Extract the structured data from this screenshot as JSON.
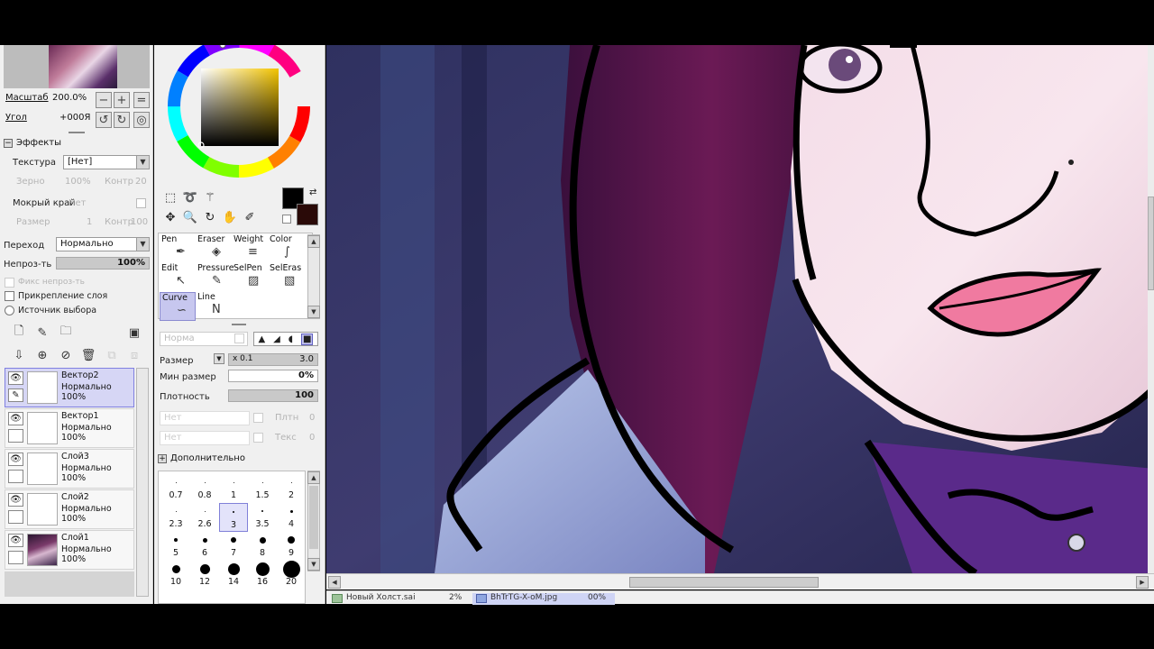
{
  "left_panel": {
    "zoom_label": "Масштаб",
    "zoom_value": "200.0%",
    "angle_label": "Угол",
    "angle_value": "+000Я",
    "effects_title": "Эффекты",
    "texture_label": "Текстура",
    "texture_value": "[Нет]",
    "grain_label": "Зерно",
    "grain_value": "100%",
    "contrast_label": "Контр",
    "contrast_value": "20",
    "wet_edge_label": "Мокрый край",
    "wet_edge_value": "Нет",
    "size_label": "Размер",
    "size_value": "1",
    "contrast2_label": "Контр",
    "contrast2_value": "100",
    "blending_label": "Переход",
    "blending_value": "Нормально",
    "opacity_label": "Непроз-ть",
    "opacity_value": "100%",
    "fix_opacity_label": "Фикс непроз-ть",
    "clip_layer_label": "Прикрепление слоя",
    "selection_source_label": "Источник выбора",
    "layers": [
      {
        "name": "Вектор2",
        "mode": "Нормально",
        "opacity": "100%",
        "selected": true
      },
      {
        "name": "Вектор1",
        "mode": "Нормально",
        "opacity": "100%",
        "selected": false
      },
      {
        "name": "Слой3",
        "mode": "Нормально",
        "opacity": "100%",
        "selected": false
      },
      {
        "name": "Слой2",
        "mode": "Нормально",
        "opacity": "100%",
        "selected": false
      },
      {
        "name": "Слой1",
        "mode": "Нормально",
        "opacity": "100%",
        "selected": false
      }
    ]
  },
  "tools": {
    "brushes": [
      {
        "label": "Pen",
        "icon": "pen-icon"
      },
      {
        "label": "Eraser",
        "icon": "eraser-icon"
      },
      {
        "label": "Weight",
        "icon": "weight-icon"
      },
      {
        "label": "Color",
        "icon": "color-icon"
      },
      {
        "label": "Edit",
        "icon": "edit-icon"
      },
      {
        "label": "Pressure",
        "icon": "pressure-icon"
      },
      {
        "label": "SelPen",
        "icon": "selpen-icon"
      },
      {
        "label": "SelEras",
        "icon": "seleras-icon"
      },
      {
        "label": "Curve",
        "icon": "curve-icon"
      },
      {
        "label": "Line",
        "icon": "line-icon"
      }
    ],
    "mode_placeholder": "Норма",
    "size_label": "Размер",
    "size_mult": "x 0.1",
    "size_value": "3.0",
    "min_size_label": "Мин размер",
    "min_size_value": "0%",
    "density_label": "Плотность",
    "density_value": "100",
    "none1": "Нет",
    "none2": "Нет",
    "plot_label": "Плтн",
    "plot_value": "0",
    "tex_label": "Текс",
    "tex_value": "0",
    "advanced_label": "Дополнительно",
    "brush_sizes": [
      {
        "label": "0.7",
        "dot": 1
      },
      {
        "label": "0.8",
        "dot": 1
      },
      {
        "label": "1",
        "dot": 1
      },
      {
        "label": "1.5",
        "dot": 1
      },
      {
        "label": "2",
        "dot": 1
      },
      {
        "label": "2.3",
        "dot": 1
      },
      {
        "label": "2.6",
        "dot": 1
      },
      {
        "label": "3",
        "dot": 2
      },
      {
        "label": "3.5",
        "dot": 2
      },
      {
        "label": "4",
        "dot": 3
      },
      {
        "label": "5",
        "dot": 4
      },
      {
        "label": "6",
        "dot": 5
      },
      {
        "label": "7",
        "dot": 6
      },
      {
        "label": "8",
        "dot": 7
      },
      {
        "label": "9",
        "dot": 8
      },
      {
        "label": "10",
        "dot": 9
      },
      {
        "label": "12",
        "dot": 11
      },
      {
        "label": "14",
        "dot": 13
      },
      {
        "label": "16",
        "dot": 15
      },
      {
        "label": "20",
        "dot": 19
      }
    ],
    "selected_size": "3"
  },
  "colors": {
    "foreground": "#000000",
    "background": "#2a0a08",
    "selection": "#8080e0"
  },
  "tabs": [
    {
      "name": "Новый Холст.sai",
      "zoom": "2%",
      "active": false
    },
    {
      "name": "BhTrTG-X-oM.jpg",
      "zoom": "00%",
      "active": true
    }
  ]
}
